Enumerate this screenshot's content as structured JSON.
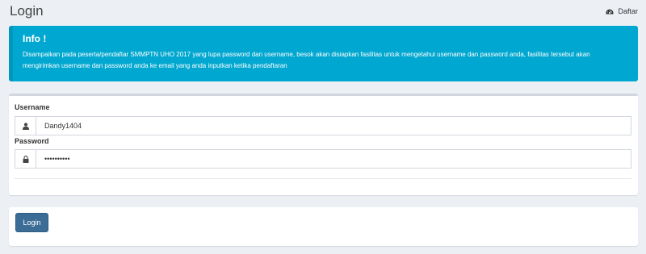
{
  "header": {
    "title": "Login",
    "link_label": "Daftar",
    "link_icon": "dashboard-icon"
  },
  "info": {
    "title": "Info !",
    "message": "Disampaikan pada peserta/pendaftar SMMPTN UHO 2017 yang lupa password dan username, besok akan disiapkan fasilitas untuk mengetahui username dan password anda, fasilitas tersebut akan mengirimkan username dan password anda ke email yang anda inputkan ketika pendaftaran",
    "background_color": "#00a7d0"
  },
  "form": {
    "username_label": "Username",
    "username_value": "Dandy1404",
    "username_icon": "user-icon",
    "password_label": "Password",
    "password_value": "••••••••••",
    "password_icon": "lock-icon"
  },
  "actions": {
    "login_label": "Login",
    "button_color": "#3c6d96"
  }
}
